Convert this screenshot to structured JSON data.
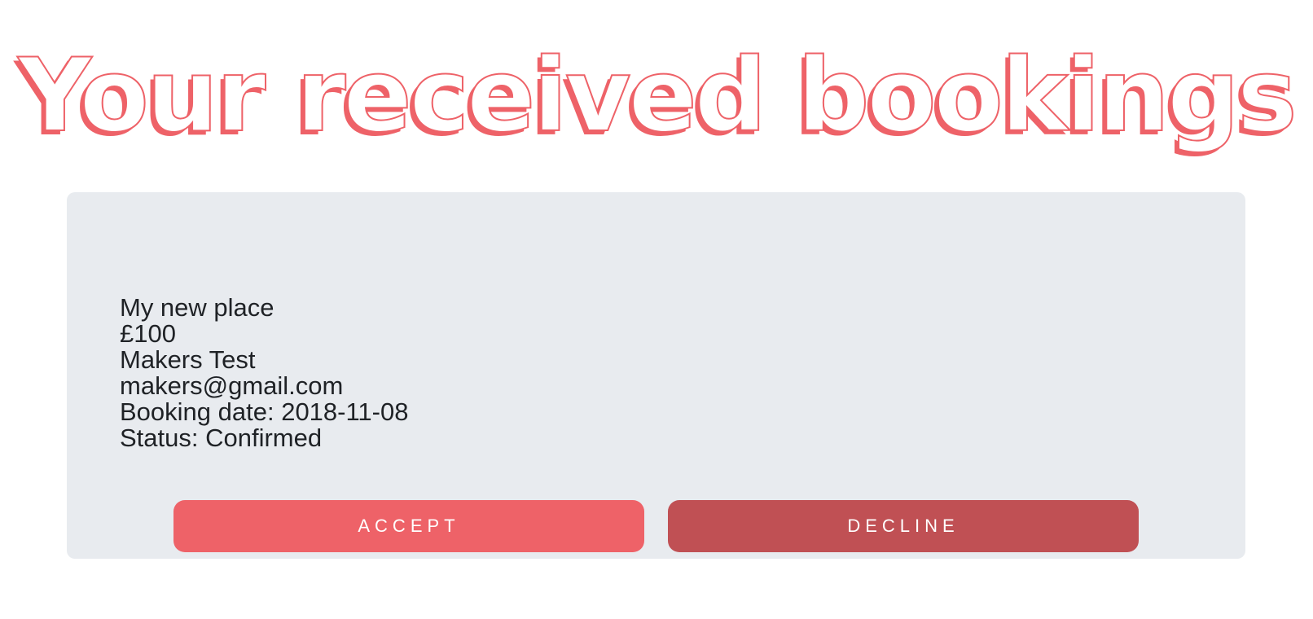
{
  "page": {
    "title": "Your received bookings"
  },
  "booking": {
    "place_name": "My new place",
    "price": "£100",
    "guest_name": "Makers Test",
    "guest_email": "makers@gmail.com",
    "booking_date": "Booking date: 2018-11-08",
    "status": "Status: Confirmed"
  },
  "actions": {
    "accept_label": "ACCEPT",
    "decline_label": "DECLINE"
  },
  "colors": {
    "accent": "#ee6268",
    "decline": "#c05054",
    "card_background": "#e8ebef",
    "text": "#1f2226"
  }
}
